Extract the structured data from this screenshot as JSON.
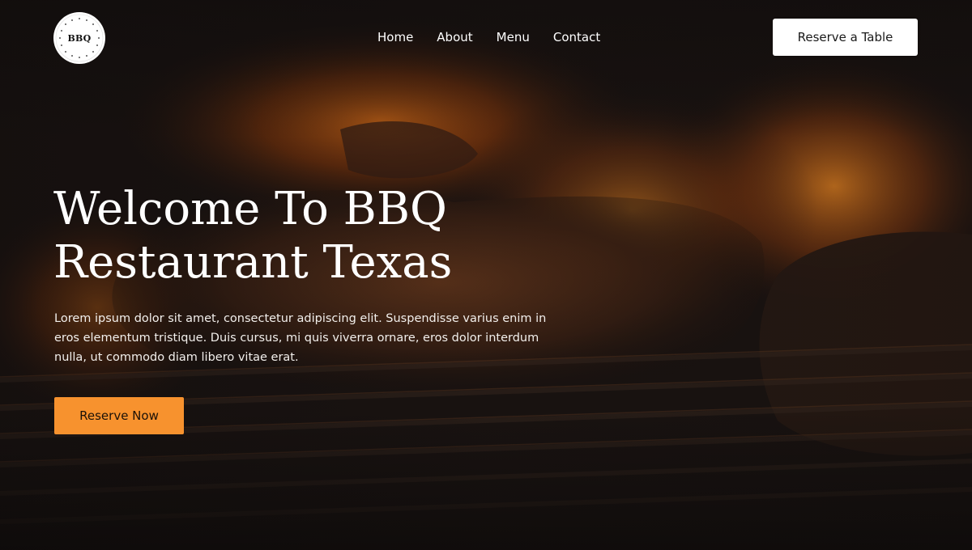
{
  "header": {
    "logo": {
      "text": "BBQ",
      "ring_text": "Restaurant Restaurant"
    },
    "nav": [
      {
        "label": "Home"
      },
      {
        "label": "About"
      },
      {
        "label": "Menu"
      },
      {
        "label": "Contact"
      }
    ],
    "cta_label": "Reserve a Table"
  },
  "hero": {
    "headline_line1": "Welcome To BBQ",
    "headline_line2": "Restaurant Texas",
    "lede_lines": [
      "Lorem ipsum dolor sit amet, consectetur adipiscing elit. Suspendisse varius enim in",
      "eros elementum tristique. Duis cursus, mi quis viverra ornare, eros dolor interdum",
      "nulla, ut commodo diam libero vitae erat."
    ],
    "cta_label": "Reserve Now",
    "background": "grilled-meat-on-flaming-grill-photo"
  },
  "colors": {
    "accent": "#f7922e",
    "background_dark": "#15110f",
    "text_light": "#ffffff"
  }
}
